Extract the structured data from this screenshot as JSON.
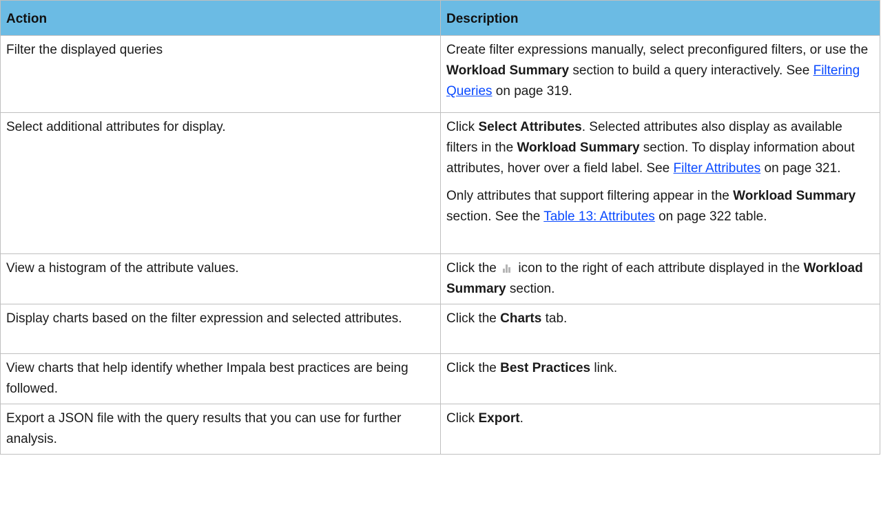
{
  "header": {
    "action": "Action",
    "description": "Description"
  },
  "rows": [
    {
      "action": "Filter the displayed queries",
      "desc": {
        "t1": "Create filter expressions manually, select preconfigured filters, or use the ",
        "b1": "Workload Summary",
        "t2": " section to build a query interactively. See ",
        "link": "Filtering Queries",
        "t3": " on page 319."
      }
    },
    {
      "action": "Select additional attributes for display.",
      "desc": {
        "t0": "Click ",
        "b0": "Select Attributes",
        "t1": ". Selected attributes also display as available filters in the ",
        "b1": "Workload Summary",
        "t2": " section. To display information about attributes, hover over a field label. See ",
        "link": "Filter Attributes",
        "t3": " on page 321."
      },
      "desc2": {
        "t1": "Only attributes that support filtering appear in the ",
        "b1": "Workload Summary",
        "t2": " section. See the ",
        "link": "Table 13: Attributes",
        "t3": " on page 322 table."
      }
    },
    {
      "action": "View a histogram of the attribute values.",
      "desc": {
        "t1": "Click the ",
        "icon": "histogram-icon",
        "t2": " icon to the right of each attribute displayed in the ",
        "b1": "Workload Summary",
        "t3": " section."
      }
    },
    {
      "action": "Display charts based on the filter expression and selected attributes.",
      "desc": {
        "t1": "Click the ",
        "b1": "Charts",
        "t2": " tab."
      }
    },
    {
      "action": "View charts that help identify whether Impala best practices are being followed.",
      "desc": {
        "t1": "Click the ",
        "b1": "Best Practices",
        "t2": " link."
      }
    },
    {
      "action": "Export a JSON file with the query results that you can use for further analysis.",
      "desc": {
        "t1": "Click ",
        "b1": "Export",
        "t2": "."
      }
    }
  ],
  "colors": {
    "header_bg": "#6bbbe4",
    "link": "#0a4aff",
    "border": "#bfbfbf"
  }
}
